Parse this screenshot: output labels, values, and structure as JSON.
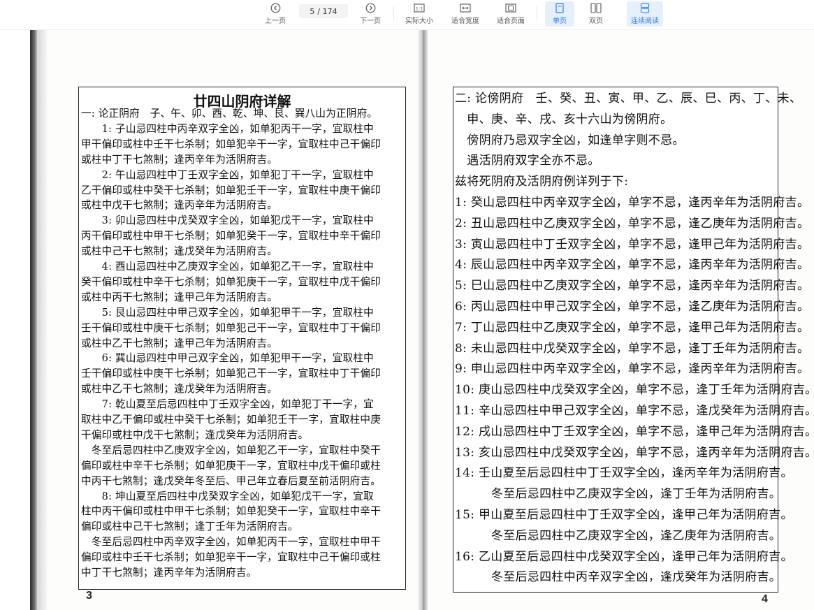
{
  "toolbar": {
    "prev_label": "上一页",
    "page_current": "5",
    "page_total": "/ 174",
    "next_label": "下一页",
    "actual_size_label": "实际大小",
    "fit_width_label": "适合宽度",
    "fit_page_label": "适合页面",
    "single_label": "单页",
    "double_label": "双页",
    "continuous_label": "连续阅读",
    "accent_color": "#2b7de9"
  },
  "left_page": {
    "title": "廿四山阴府详解",
    "number": "3",
    "lines": [
      "一: 论正阴府　子、午、卯、酉、乾、坤、艮、巽八山为正阴府。",
      "　　1: 子山忌四柱中丙辛双字全凶，如单犯丙干一字，宜取柱中",
      "甲干偏印或柱中壬干七杀制；如单犯辛干一字，宜取柱中己干偏印",
      "或柱中丁干七煞制；逢丙辛年为活阴府吉。",
      "　　2: 午山忌四柱中丁壬双字全凶，如单犯丁干一字，宜取柱中",
      "乙干偏印或柱中癸干七杀制；如单犯壬干一字，宜取柱中庚干偏印",
      "或柱中戊干七煞制；逢丙辛年为活阴府吉。",
      "　　3: 卯山忌四柱中戊癸双字全凶，如单犯戊干一字，宜取柱中",
      "丙干偏印或柱中甲干七杀制；如单犯癸干一字，宜取柱中辛干偏印",
      "或柱中己干七煞制；逢戊癸年为活阴府吉。",
      "　　4: 酉山忌四柱中乙庚双字全凶，如单犯乙干一字，宜取柱中",
      "癸干偏印或柱中辛干七杀制；如单犯庚干一字，宜取柱中戊干偏印",
      "或柱中丙干七煞制；逢甲己年为活阴府吉。",
      "　　5: 艮山忌四柱中甲己双字全凶，如单犯甲干一字，宜取柱中",
      "壬干偏印或柱中庚干七杀制；如单犯己干一字，宜取柱中丁干偏印",
      "或柱中乙干七煞制；逢甲己年为活阴府吉。",
      "　　6: 巽山忌四柱中甲己双字全凶，如单犯甲干一字，宜取柱中",
      "壬干偏印或柱中庚干七杀制；如单犯己干一字，宜取柱中丁干偏印",
      "或柱中乙干七煞制；逢戊癸年为活阴府吉。",
      "　　7: 乾山夏至后忌四柱中丁壬双字全凶，如单犯丁干一字，宜",
      "取柱中乙干偏印或柱中癸干七杀制；如单犯壬干一字，宜取柱中庚",
      "干偏印或柱中戊干七煞制；逢戊癸年为活阴府吉。",
      "　冬至后忌四柱中乙庚双字全凶，如单犯乙干一字，宜取柱中癸干",
      "偏印或柱中辛干七杀制；如单犯庚干一字，宜取柱中戊干偏印或柱",
      "中丙干七煞制；逢戊癸年冬至后、甲己年立春后夏至前活阴府吉。",
      "　　8: 坤山夏至后四柱中戊癸双字全凶，如单犯戊干一字，宜取",
      "柱中丙干偏印或柱中甲干七杀制；如单犯癸干一字，宜取柱中辛干",
      "偏印或柱中己干七煞制；逢丁壬年为活阴府吉。",
      "　冬至后忌四柱中丙辛双字全凶，如单犯丙干一字，宜取柱中甲干",
      "偏印或柱中壬干七杀制；如单犯辛干一字，宜取柱中己干偏印或柱",
      "中丁干七煞制；逢丙辛年为活阴府吉。"
    ]
  },
  "right_page": {
    "number": "4",
    "lines": [
      "二: 论傍阴府　壬、癸、丑、寅、甲、乙、辰、巳、丙、丁、未、",
      "　申、庚、辛、戌、亥十六山为傍阴府。",
      "　傍阴府乃忌双字全凶，如逢单字则不忌。",
      "　遇活阴府双字全亦不忌。",
      "兹将死阴府及活阴府例详列于下:",
      "1: 癸山忌四柱中丙辛双字全凶，单字不忌，逢丙辛年为活阴府吉。",
      "2: 丑山忌四柱中乙庚双字全凶，单字不忌，逢乙庚年为活阴府吉。",
      "3: 寅山忌四柱中丁壬双字全凶，单字不忌，逢甲己年为活阴府吉。",
      "4: 辰山忌四柱中丙辛双字全凶，单字不忌，逢丙辛年为活阴府吉。",
      "5: 巳山忌四柱中乙庚双字全凶，单字不忌，逢丙辛年为活阴府吉。",
      "6: 丙山忌四柱中甲己双字全凶，单字不忌，逢乙庚年为活阴府吉。",
      "7: 丁山忌四柱中乙庚双字全凶，单字不忌，逢甲己年为活阴府吉。",
      "8: 未山忌四柱中戊癸双字全凶，单字不忌，逢丁壬年为活阴府吉。",
      "9: 申山忌四柱中丙辛双字全凶，单字不忌，逢丙辛年为活阴府吉。",
      "10: 庚山忌四柱中戊癸双字全凶，单字不忌，逢丁壬年为活阴府吉。",
      "11: 辛山忌四柱中甲己双字全凶，单字不忌，逢戊癸年为活阴府吉。",
      "12: 戌山忌四柱中丁壬双字全凶，单字不忌，逢甲己年为活阴府吉。",
      "13: 亥山忌四柱中戊癸双字全凶，单字不忌，逢丙辛年为活阴府吉。",
      "14: 壬山夏至后忌四柱中丁壬双字全凶，逢丙辛年为活阴府吉。",
      "　　　冬至后忌四柱中乙庚双字全凶，逢丁壬年为活阴府吉。",
      "15: 甲山夏至后忌四柱中丁壬双字全凶，逢甲己年为活阴府吉。",
      "　　　冬至后忌四柱中乙庚双字全凶，逢乙庚年为活阴府吉。",
      "16: 乙山夏至后忌四柱中戊癸双字全凶，逢甲己年为活阴府吉。",
      "　　　冬至后忌四柱中丙辛双字全凶，逢戊癸年为活阴府吉。"
    ]
  }
}
